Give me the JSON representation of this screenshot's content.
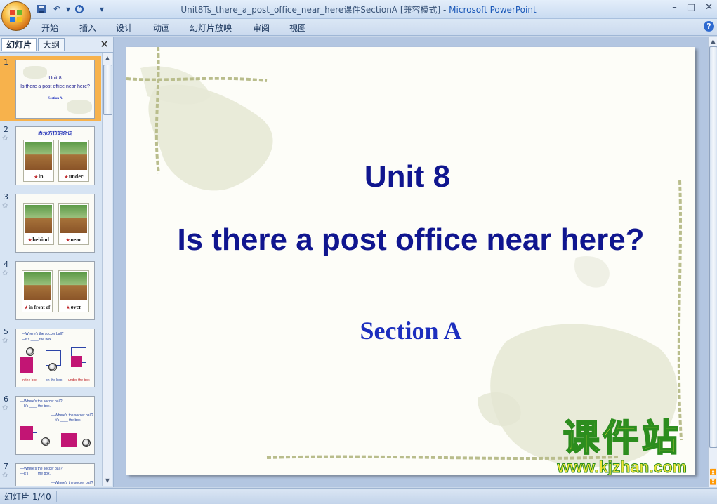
{
  "window": {
    "title_doc": "Unit8Ts_there_a_post_office_near_here课件SectionA [兼容模式]",
    "title_sep": " - ",
    "title_app": "Microsoft PowerPoint",
    "controls": [
      "–",
      "□",
      "✕"
    ]
  },
  "ribbon": {
    "tabs": [
      "开始",
      "插入",
      "设计",
      "动画",
      "幻灯片放映",
      "审阅",
      "视图"
    ],
    "help": "?"
  },
  "panel": {
    "tab_slides": "幻灯片",
    "tab_outline": "大纲",
    "close": "✕"
  },
  "thumbnails": [
    {
      "num": "1",
      "title": "Unit 8",
      "subtitle": "Is there a post office near here?",
      "section": "Section A"
    },
    {
      "num": "2",
      "heading": "表示方位的介词",
      "labels": [
        "in",
        "under"
      ]
    },
    {
      "num": "3",
      "labels": [
        "behind",
        "near"
      ]
    },
    {
      "num": "4",
      "labels": [
        "in front of",
        "over"
      ]
    },
    {
      "num": "5",
      "lines": [
        "—Where's the soccer ball?",
        "—It's ____ the box."
      ],
      "captions": [
        "in the box",
        "on the box",
        "under the box"
      ]
    },
    {
      "num": "6",
      "lines": [
        "—Where's the soccer ball?",
        "—It's ____ the box.",
        "—Where's the soccer ball?",
        "—It's ____ the box."
      ]
    },
    {
      "num": "7",
      "lines": [
        "—Where's the soccer ball?",
        "—It's ____ the box.",
        "—Where's the soccer ball?"
      ]
    }
  ],
  "slide": {
    "title": "Unit 8",
    "subtitle": "Is there a post office near here?",
    "section": "Section A"
  },
  "watermark": {
    "text": "课件站",
    "url": "www.kjzhan.com"
  },
  "status": {
    "slide_counter": "幻灯片 1/40"
  },
  "colors": {
    "slide_text": "#10168f",
    "section_text": "#1d2fbe",
    "selected_thumb": "#f7b24c",
    "watermark_fill": "#f2e63a",
    "watermark_stroke": "#2c8d1e"
  }
}
